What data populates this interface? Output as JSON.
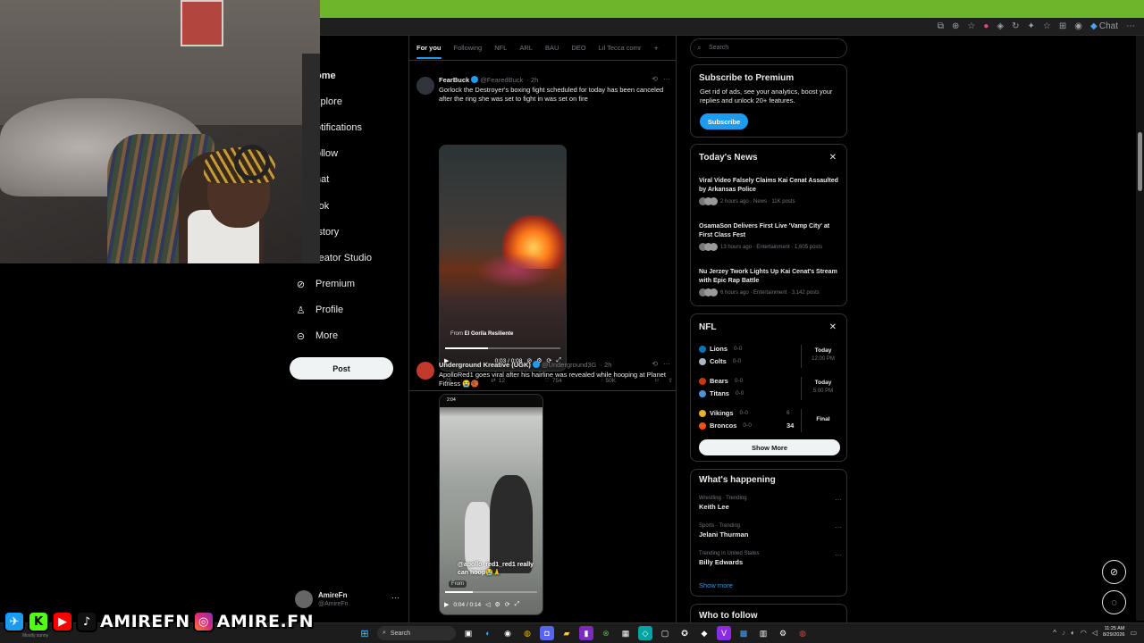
{
  "browser": {
    "chat_label": "Chat"
  },
  "nav": {
    "items": [
      {
        "label": "Home",
        "icon": "home-icon"
      },
      {
        "label": "Explore",
        "icon": "search-icon"
      },
      {
        "label": "Notifications",
        "icon": "bell-icon"
      },
      {
        "label": "Follow",
        "icon": "follow-icon"
      },
      {
        "label": "Chat",
        "icon": "chat-icon"
      },
      {
        "label": "Grok",
        "icon": "grok-icon"
      },
      {
        "label": "History",
        "icon": "history-icon"
      },
      {
        "label": "Creator Studio",
        "icon": "creator-studio-icon"
      },
      {
        "label": "Premium",
        "icon": "premium-icon"
      },
      {
        "label": "Profile",
        "icon": "person-icon"
      },
      {
        "label": "More",
        "icon": "more-circle-icon"
      }
    ],
    "visible_labels": [
      "ome",
      "xplore",
      "otifications",
      "ollow",
      "hat",
      "rok",
      "istory",
      "reator Studio",
      "Premium",
      "Profile",
      "More"
    ],
    "post_label": "Post",
    "account": {
      "name": "AmireFn",
      "handle": "@AmireFn"
    }
  },
  "feed": {
    "tabs": [
      "For you",
      "Following",
      "NFL",
      "ARL",
      "BAU",
      "DEO",
      "Lil Tecca comr"
    ],
    "active_tab": "For you",
    "prev_stats": [
      "694",
      "11K",
      "1.1K",
      "1.1M"
    ],
    "tweets": [
      {
        "name": "FearBuck",
        "handle": "@FearedBuck",
        "time": "· 2h",
        "text": "Gorlock the Destroyer's boxing fight scheduled for today has been canceled after the ring she was set to fight in was set on fire",
        "video": {
          "from_prefix": "From",
          "from_name": "El Gorila Resiliente",
          "time": "0:03 / 0:08",
          "progress": 0.37
        },
        "stats": {
          "replies": "25",
          "reposts": "12",
          "likes": "754",
          "views": "50K"
        }
      },
      {
        "name": "Underground Kreative (UGK)",
        "handle": "@Underground3G",
        "time": "· 2h",
        "text": "ApolloRed1 goes viral after his hairline was revealed while hooping at Planet Fitness 😭🏀",
        "video": {
          "from_prefix": "From",
          "time": "0:04 / 0:14",
          "progress": 0.3,
          "overlay_text": "@apollo_red1_red1 really can hoop😭🙏",
          "phone_time": "2:04"
        }
      }
    ]
  },
  "right": {
    "search_placeholder": "Search",
    "premium": {
      "title": "Subscribe to Premium",
      "desc": "Get rid of ads, see your analytics, boost your replies and unlock 20+ features.",
      "button": "Subscribe"
    },
    "news": {
      "title": "Today's News",
      "items": [
        {
          "title": "Viral Video Falsely Claims Kai Cenat Assaulted by Arkansas Police",
          "meta": "2 hours ago · News · 11K posts"
        },
        {
          "title": "OsamaSon Delivers First Live 'Vamp City' at First Class Fest",
          "meta": "13 hours ago · Entertainment · 1,605 posts"
        },
        {
          "title": "Nu Jerzey Twork Lights Up Kai Cenat's Stream with Epic Rap Battle",
          "meta": "6 hours ago · Entertainment · 3,142 posts"
        }
      ]
    },
    "nfl": {
      "title": "NFL",
      "games": [
        {
          "home": "Lions",
          "home_rec": "0-0",
          "away": "Colts",
          "away_rec": "0-0",
          "home_score": "",
          "away_score": "",
          "when": "Today",
          "time": "12:00 PM",
          "home_color": "#0076b6",
          "away_color": "#aab4c4"
        },
        {
          "home": "Bears",
          "home_rec": "0-0",
          "away": "Titans",
          "away_rec": "0-0",
          "home_score": "",
          "away_score": "",
          "when": "Today",
          "time": "5:00 PM",
          "home_color": "#c83803",
          "away_color": "#4b92db"
        },
        {
          "home": "Vikings",
          "home_rec": "0-0",
          "away": "Broncos",
          "away_rec": "0-0",
          "home_score": "6",
          "away_score": "34",
          "when": "Final",
          "time": "",
          "home_color": "#e6b325",
          "away_color": "#fb4f14"
        }
      ],
      "show_more": "Show More"
    },
    "happening": {
      "title": "What's happening",
      "trends": [
        {
          "meta": "Wrestling · Trending",
          "name": "Keith Lee"
        },
        {
          "meta": "Sports · Trending",
          "name": "Jelani Thurman"
        },
        {
          "meta": "Trending in United States",
          "name": "Billy Edwards"
        }
      ],
      "show_more": "Show more"
    },
    "who_to_follow": "Who to follow"
  },
  "overlay": {
    "handle1": "AMIREFN",
    "handle2": "AMIRE.FN",
    "weather": "Mostly sunny"
  },
  "taskbar": {
    "search_label": "Search",
    "time": "11:25 AM",
    "date": "8/29/2026"
  }
}
